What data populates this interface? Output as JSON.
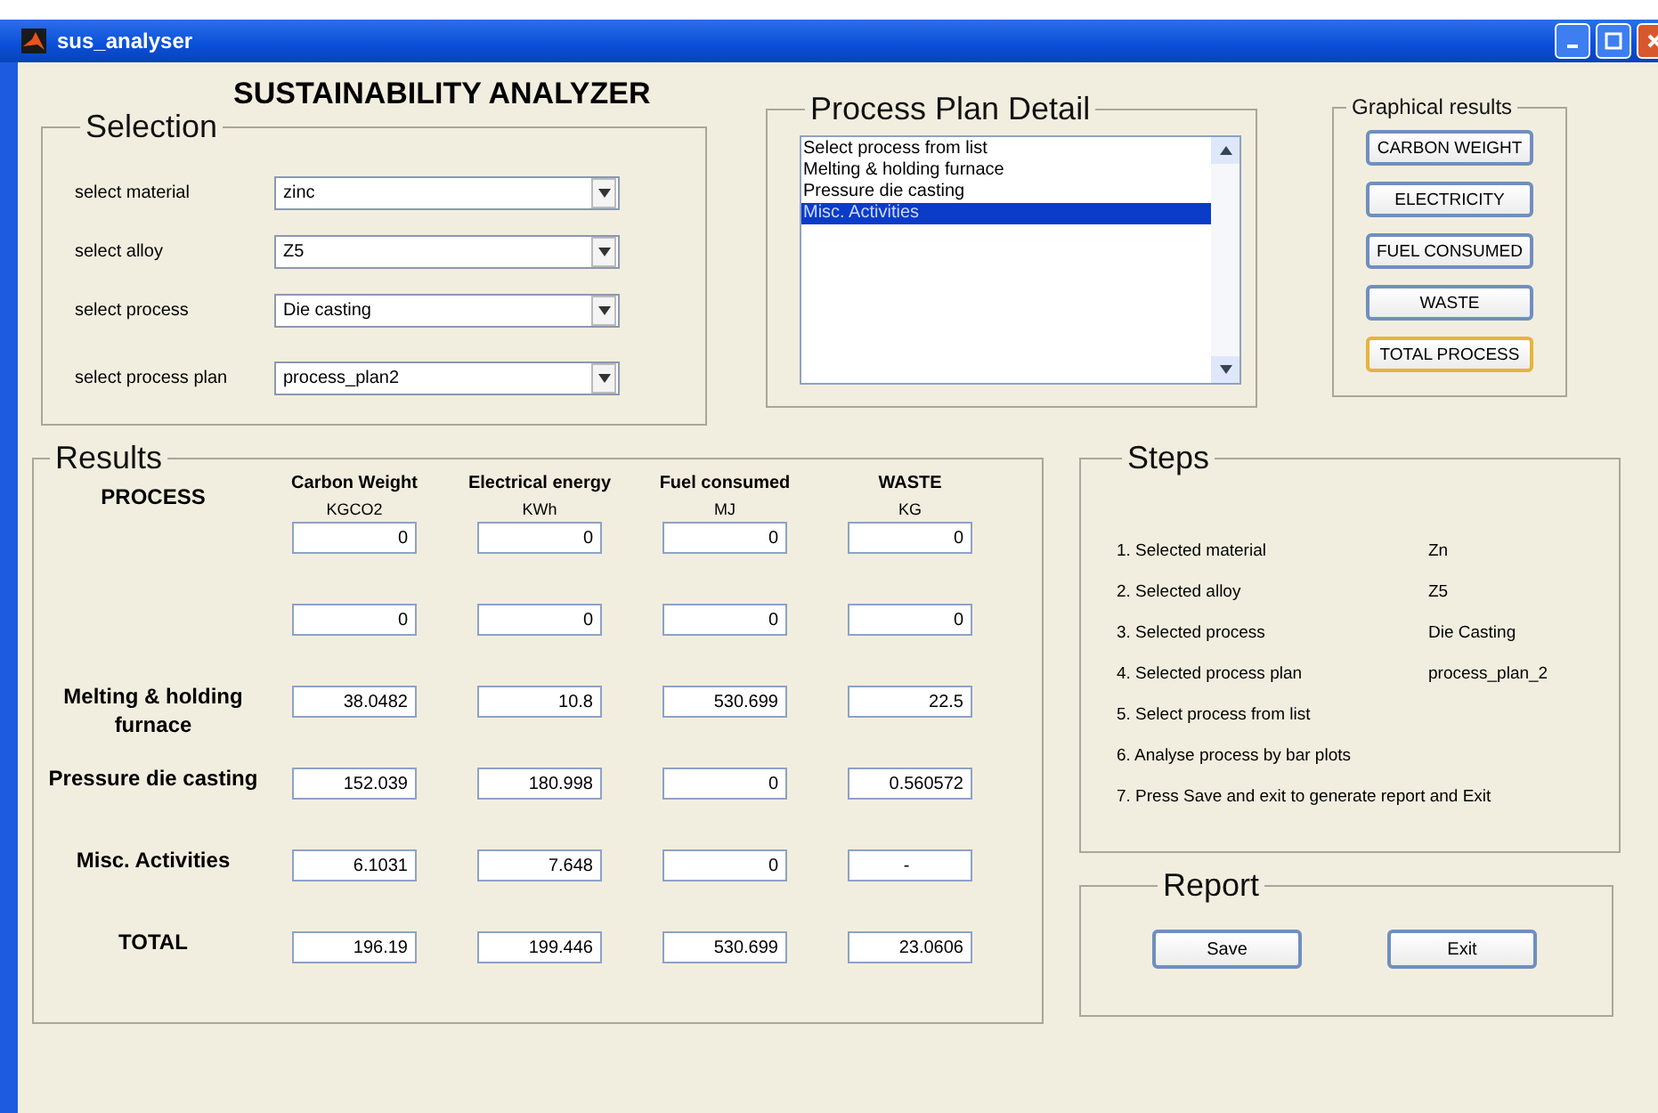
{
  "window": {
    "title": "sus_analyser"
  },
  "app_title": "SUSTAINABILITY ANALYZER",
  "selection": {
    "title": "Selection",
    "fields": [
      {
        "label": "select material",
        "value": "zinc"
      },
      {
        "label": "select alloy",
        "value": "Z5"
      },
      {
        "label": "select process",
        "value": "Die casting"
      },
      {
        "label": "select process plan",
        "value": "process_plan2"
      }
    ]
  },
  "process_plan_detail": {
    "title": "Process Plan Detail",
    "items": [
      {
        "label": "Select process from list",
        "selected": false
      },
      {
        "label": "Melting & holding furnace",
        "selected": false
      },
      {
        "label": "Pressure die casting",
        "selected": false
      },
      {
        "label": "Misc. Activities",
        "selected": true
      }
    ]
  },
  "graphical_results": {
    "title": "Graphical results",
    "buttons": [
      {
        "label": "CARBON WEIGHT",
        "focused": false
      },
      {
        "label": "ELECTRICITY",
        "focused": false
      },
      {
        "label": "FUEL CONSUMED",
        "focused": false
      },
      {
        "label": "WASTE",
        "focused": false
      },
      {
        "label": "TOTAL PROCESS",
        "focused": true
      }
    ]
  },
  "results": {
    "title": "Results",
    "process_heading": "PROCESS",
    "columns": [
      {
        "name": "Carbon Weight",
        "unit": "KGCO2"
      },
      {
        "name": "Electrical energy",
        "unit": "KWh"
      },
      {
        "name": "Fuel consumed",
        "unit": "MJ"
      },
      {
        "name": "WASTE",
        "unit": "KG"
      }
    ],
    "rows": [
      {
        "values": [
          "0",
          "0",
          "0",
          "0"
        ]
      },
      {
        "values": [
          "0",
          "0",
          "0",
          "0"
        ]
      },
      {
        "process": "Melting & holding furnace",
        "values": [
          "38.0482",
          "10.8",
          "530.699",
          "22.5"
        ]
      },
      {
        "process": "Pressure die casting",
        "values": [
          "152.039",
          "180.998",
          "0",
          "0.560572"
        ]
      },
      {
        "process": "Misc. Activities",
        "values": [
          "6.1031",
          "7.648",
          "0",
          "-"
        ]
      },
      {
        "process": "TOTAL",
        "values": [
          "196.19",
          "199.446",
          "530.699",
          "23.0606"
        ]
      }
    ]
  },
  "steps": {
    "title": "Steps",
    "items": [
      {
        "label": "1. Selected material",
        "value": "Zn"
      },
      {
        "label": "2.  Selected alloy",
        "value": "Z5"
      },
      {
        "label": "3. Selected process",
        "value": "Die Casting"
      },
      {
        "label": "4. Selected process plan",
        "value": "process_plan_2"
      },
      {
        "label": "5. Select process from list"
      },
      {
        "label": "6. Analyse process by bar plots"
      },
      {
        "label": "7. Press Save and exit to generate report and  Exit"
      }
    ]
  },
  "report": {
    "title": "Report",
    "buttons": [
      "Save",
      "Exit"
    ]
  }
}
